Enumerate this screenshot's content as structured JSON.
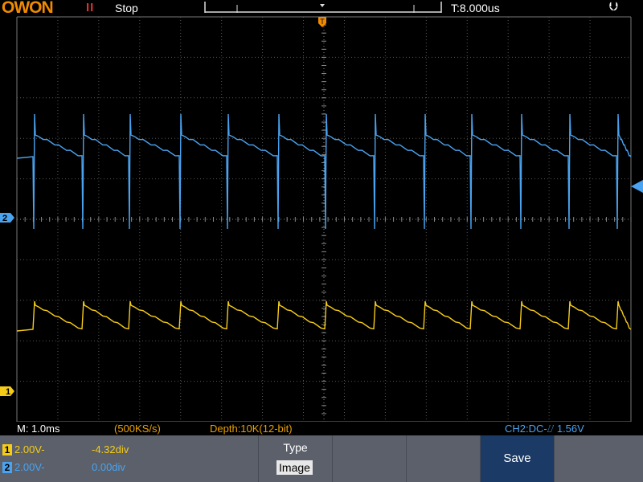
{
  "brand": {
    "logo_text": "OWON",
    "color": "#f08a00"
  },
  "status": {
    "run_icon": "pause-icon",
    "state": "Stop",
    "timebase_offset": "T:8.000us",
    "usb_icon": "usb-icon"
  },
  "markers": {
    "trigger_top": "T",
    "ch2_marker": "2",
    "ch1_marker": "1"
  },
  "info": {
    "timebase": "M: 1.0ms",
    "sample_rate": "(500KS/s)",
    "depth": "Depth:10K(12-bit)",
    "trigger": "CH2:DC-⌰ 1.56V"
  },
  "channels": [
    {
      "number": "1",
      "scale": "2.00V-",
      "position": "-4.32div",
      "color": "#f5cc18"
    },
    {
      "number": "2",
      "scale": "2.00V-",
      "position": "0.00div",
      "color": "#4aa3f0"
    }
  ],
  "menu": {
    "type_label": "Type",
    "type_value": "Image",
    "save_label": "Save"
  },
  "colors": {
    "ch1": "#f5cc18",
    "ch2": "#4aa3f0",
    "grid": "#5a5a5a",
    "menu_bg": "#5b606b",
    "save_bg": "#1b3a66",
    "info_text": "#e8a000"
  }
}
